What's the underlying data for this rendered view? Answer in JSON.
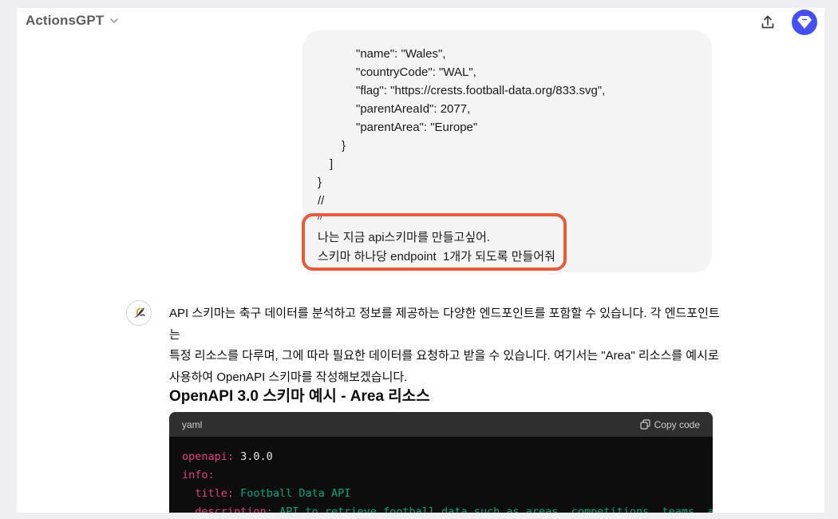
{
  "header": {
    "app_title": "ActionsGPT"
  },
  "user_message": {
    "code_lines": [
      "\"name\": \"Wales\",",
      "\"countryCode\": \"WAL\",",
      "\"flag\": \"https://crests.football-data.org/833.svg\",",
      "\"parentAreaId\": 2077,",
      "\"parentArea\": \"Europe\"",
      "}",
      "]",
      "}",
      "//",
      "//"
    ],
    "request_line1": "나는 지금 api스키마를 만들고싶어.",
    "request_line2": "스키마 하나당 endpoint  1개가 되도록 만들어줘"
  },
  "assistant": {
    "paragraph_line1": "API 스키마는 축구 데이터를 분석하고 정보를 제공하는 다양한 엔드포인트를 포함할 수 있습니다. 각 엔드포인트는",
    "paragraph_line2": "특정 리소스를 다루며, 그에 따라 필요한 데이터를 요청하고 받을 수 있습니다. 여기서는 \"Area\" 리소스를 예시로",
    "paragraph_line3": "사용하여 OpenAPI 스키마를 작성해보겠습니다.",
    "heading": "OpenAPI 3.0 스키마 예시 - Area 리소스",
    "code_block": {
      "language": "yaml",
      "copy_label": "Copy code",
      "lines": [
        {
          "key": "openapi:",
          "value": " 3.0.0",
          "indent": ""
        },
        {
          "key": "info:",
          "value": "",
          "indent": ""
        },
        {
          "key": "title:",
          "value": " Football Data API",
          "indent": "  "
        },
        {
          "key": "description:",
          "value": " API to retrieve football data such as areas, competitions, teams, a",
          "indent": "  "
        }
      ]
    }
  },
  "colors": {
    "highlight_border": "#e75a3c",
    "avatar_bg": "#4450f2",
    "yaml_key": "#e2407f",
    "yaml_string": "#00a67d"
  }
}
